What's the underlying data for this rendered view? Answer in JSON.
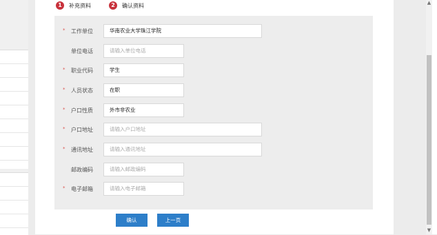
{
  "steps": [
    {
      "num": "1",
      "label": "补充资料"
    },
    {
      "num": "2",
      "label": "确认资料"
    }
  ],
  "form": {
    "fields": [
      {
        "label": "工作单位",
        "required": true,
        "value": "华南农业大学珠江学院",
        "placeholder": "",
        "width": "long"
      },
      {
        "label": "单位电话",
        "required": false,
        "value": "",
        "placeholder": "请输入单位电话",
        "width": "short"
      },
      {
        "label": "职业代码",
        "required": true,
        "value": "学生",
        "placeholder": "",
        "width": "short"
      },
      {
        "label": "人员状态",
        "required": true,
        "value": "在职",
        "placeholder": "",
        "width": "short"
      },
      {
        "label": "户口性质",
        "required": true,
        "value": "外市非农业",
        "placeholder": "",
        "width": "short"
      },
      {
        "label": "户口地址",
        "required": true,
        "value": "",
        "placeholder": "请输入户口地址",
        "width": "long"
      },
      {
        "label": "通讯地址",
        "required": true,
        "value": "",
        "placeholder": "请输入通讯地址",
        "width": "long"
      },
      {
        "label": "邮政编码",
        "required": false,
        "value": "",
        "placeholder": "请输入邮政编码",
        "width": "short"
      },
      {
        "label": "电子邮箱",
        "required": true,
        "value": "",
        "placeholder": "请输入电子邮箱",
        "width": "short"
      }
    ],
    "required_mark": "*"
  },
  "buttons": {
    "confirm": "确认",
    "previous": "上一页"
  },
  "colors": {
    "step_badge": "#c8323c",
    "primary_button": "#2d7ec9",
    "required_mark": "#d9534f",
    "form_background": "#ededed"
  }
}
